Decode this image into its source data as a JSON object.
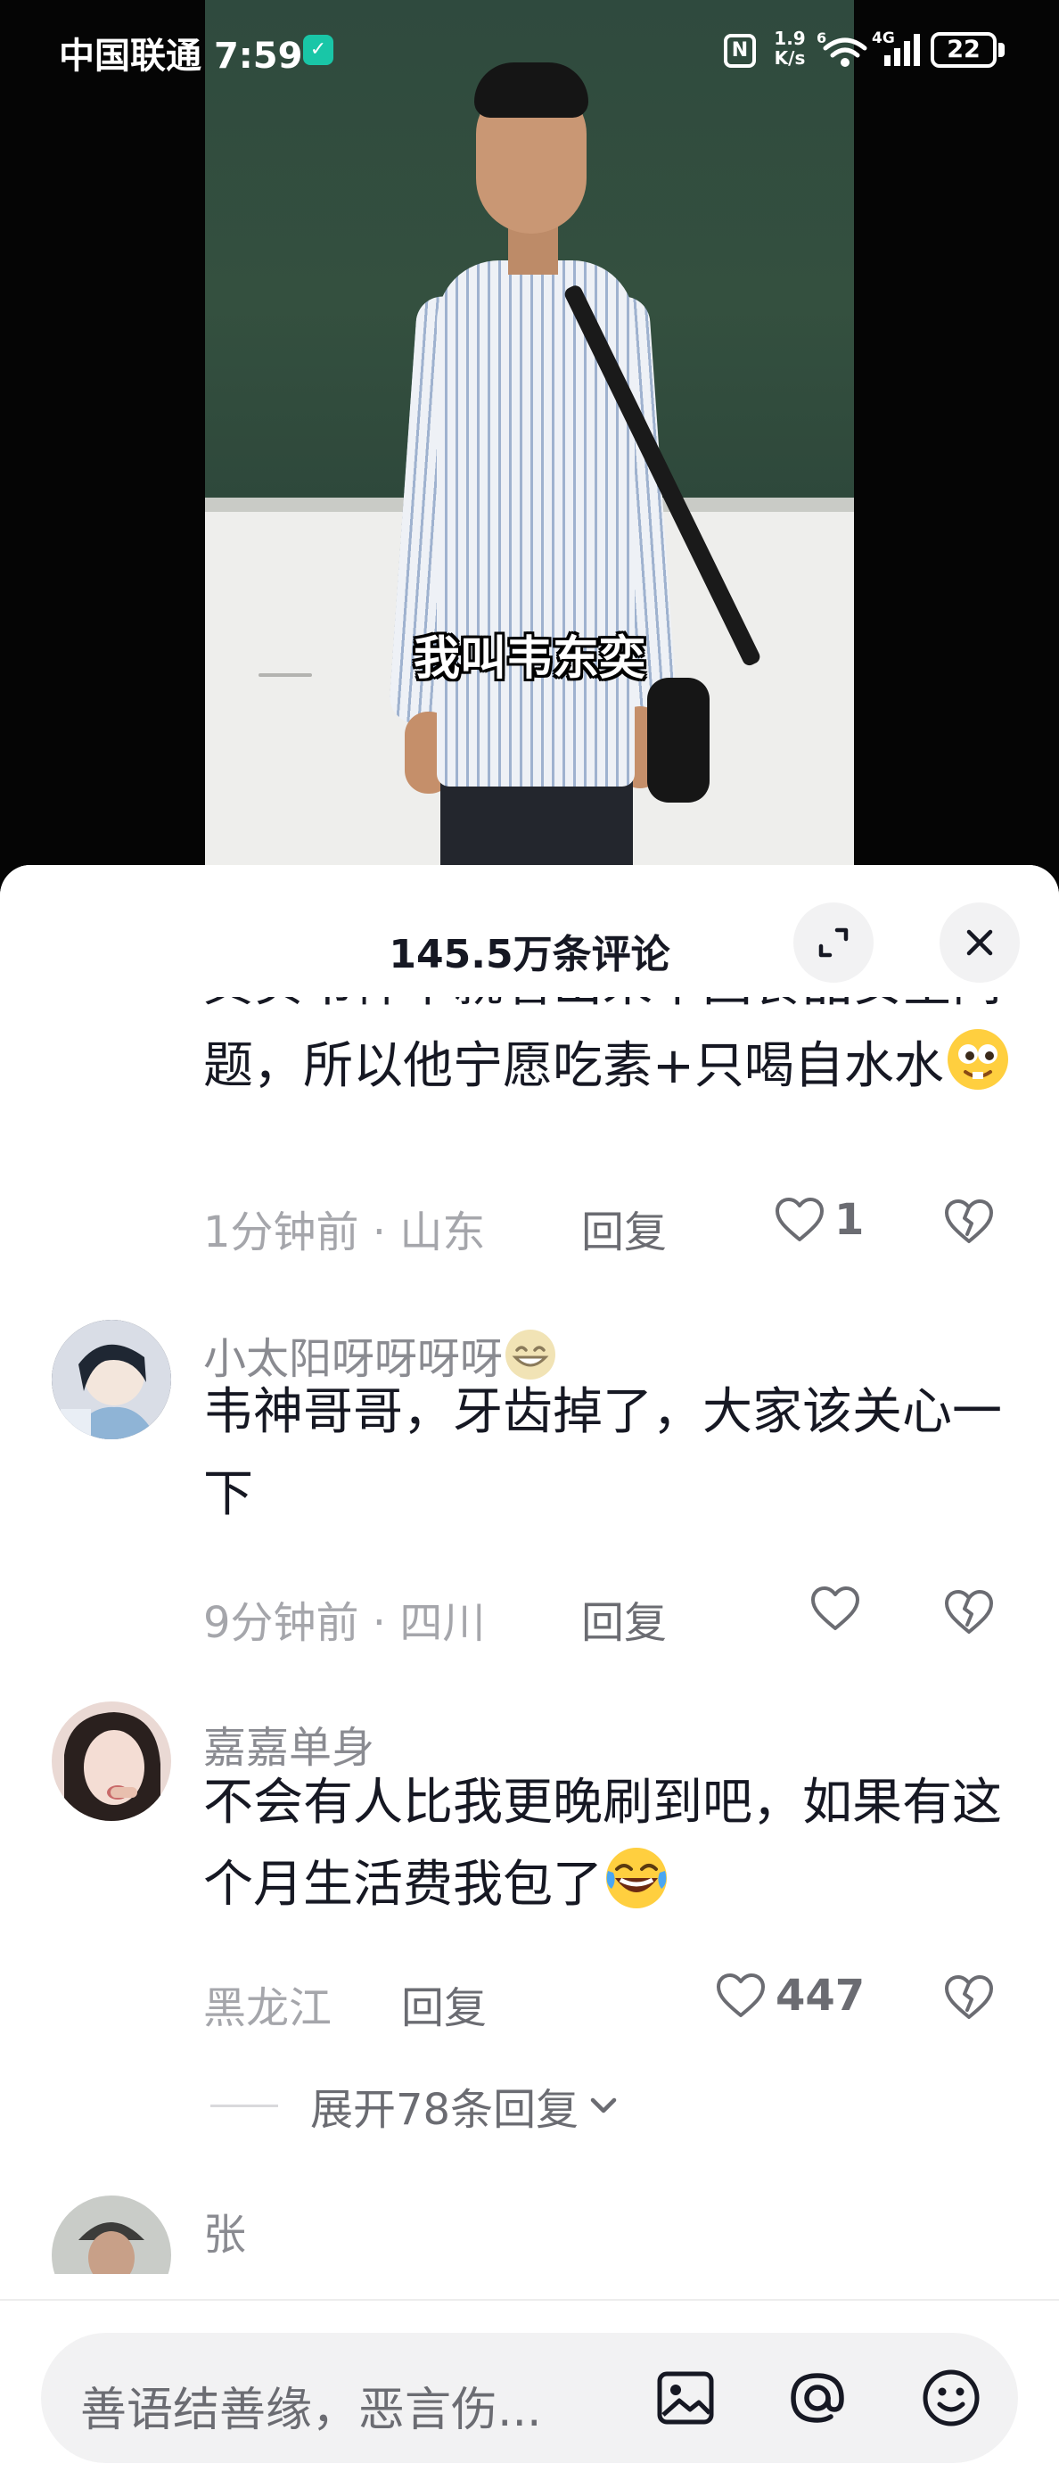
{
  "status_bar": {
    "carrier": "中国联通",
    "time": "7:59",
    "nfc": "N",
    "speed_value": "1.9",
    "speed_unit": "K/s",
    "wifi_badge": "6",
    "network": "4G",
    "battery": "22",
    "icons": [
      "shield-check-icon",
      "nfc-icon",
      "wifi-6-icon",
      "signal-4g-icon",
      "battery-icon"
    ]
  },
  "video": {
    "caption": "我叫韦东奕"
  },
  "comments_panel": {
    "title": "145.5万条评论",
    "expand_icon": "expand-icon",
    "close_icon": "close-icon"
  },
  "comments": [
    {
      "text": "其实韦神早就看出来中国食品安全问题，所以他宁愿吃素+只喝自水水",
      "emoji": "drooling-face-emoji",
      "time_location": "1分钟前 · 山东",
      "reply_label": "回复",
      "likes": "1"
    },
    {
      "user": "小太阳呀呀呀呀",
      "user_emoji": "grinning-face-emoji",
      "text": "韦神哥哥，牙齿掉了，大家该关心一下",
      "time_location": "9分钟前 · 四川",
      "reply_label": "回复",
      "likes": ""
    },
    {
      "user": "嘉嘉单身",
      "text": "不会有人比我更晚刷到吧，如果有这个月生活费我包了",
      "emoji": "rolling-laughing-emoji",
      "time_location": "黑龙江",
      "reply_label": "回复",
      "likes": "447",
      "expand_label": "展开78条回复"
    },
    {
      "user": "张"
    }
  ],
  "input_bar": {
    "placeholder": "善语结善缘，恶言伤...",
    "icons": [
      "image-icon",
      "at-icon",
      "emoji-icon"
    ]
  },
  "colors": {
    "sheet_bg": "#ffffff",
    "text_primary": "#161823",
    "text_secondary": "#8a8b91",
    "accent_status": "#19c6a7"
  }
}
